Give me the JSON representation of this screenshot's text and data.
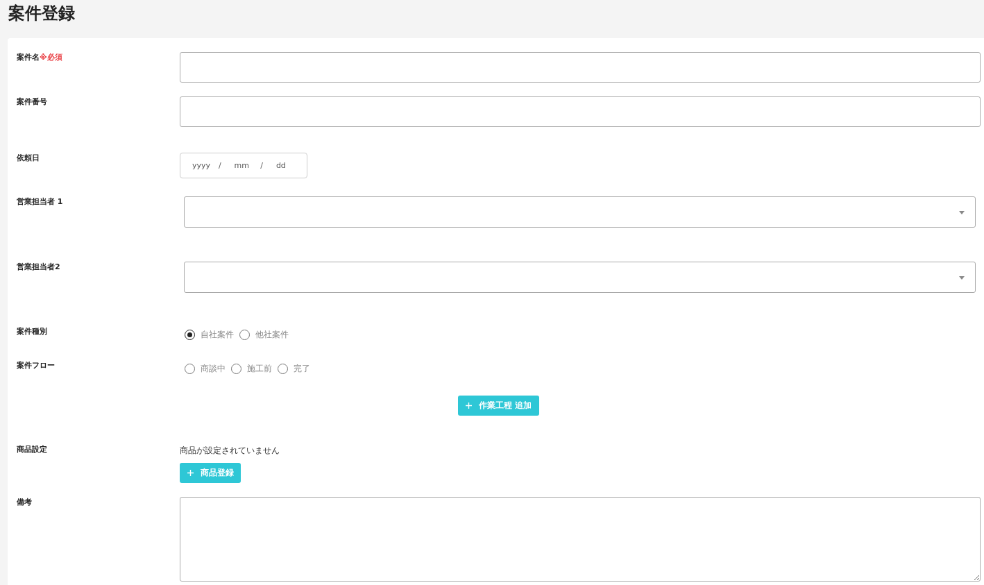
{
  "title": "案件登録",
  "fields": [
    {
      "kind": "text",
      "label": "案件名",
      "required": "※必須"
    },
    {
      "kind": "text",
      "label": "案件番号"
    },
    {
      "kind": "date",
      "label": "依頼日",
      "segments": [
        {
          "kind": "field",
          "placeholder": "yyyy"
        },
        {
          "kind": "separator",
          "text": "/"
        },
        {
          "kind": "field",
          "placeholder": "mm"
        },
        {
          "kind": "separator",
          "text": "/"
        },
        {
          "kind": "field",
          "placeholder": "dd"
        }
      ]
    },
    {
      "kind": "select",
      "label": "営業担当者 1"
    },
    {
      "kind": "select",
      "label": "営業担当者2"
    },
    {
      "kind": "radio",
      "label": "案件種別",
      "options": [
        {
          "label": "自社案件",
          "selected": true
        },
        {
          "label": "他社案件",
          "selected": false
        }
      ]
    },
    {
      "kind": "radio",
      "label": "案件フロー",
      "options": [
        {
          "label": "商談中",
          "selected": false
        },
        {
          "label": "施工前",
          "selected": false
        },
        {
          "label": "完了",
          "selected": false
        }
      ]
    },
    {
      "kind": "button",
      "button": "作業工程 追加"
    },
    {
      "kind": "products",
      "label": "商品設定",
      "message": "商品が設定されていません",
      "button": "商品登録"
    },
    {
      "kind": "textarea",
      "label": "備考"
    }
  ]
}
